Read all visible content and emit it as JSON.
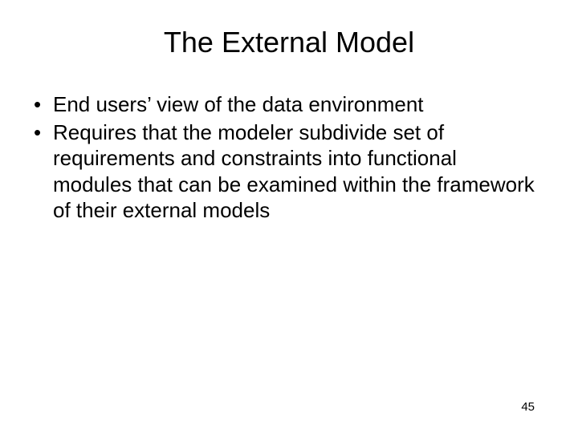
{
  "title": "The External Model",
  "bullets": [
    "End users’ view of the data environment",
    "Requires that the modeler subdivide set of requirements and constraints into functional modules that can be examined within the framework of their external models"
  ],
  "page_number": "45"
}
